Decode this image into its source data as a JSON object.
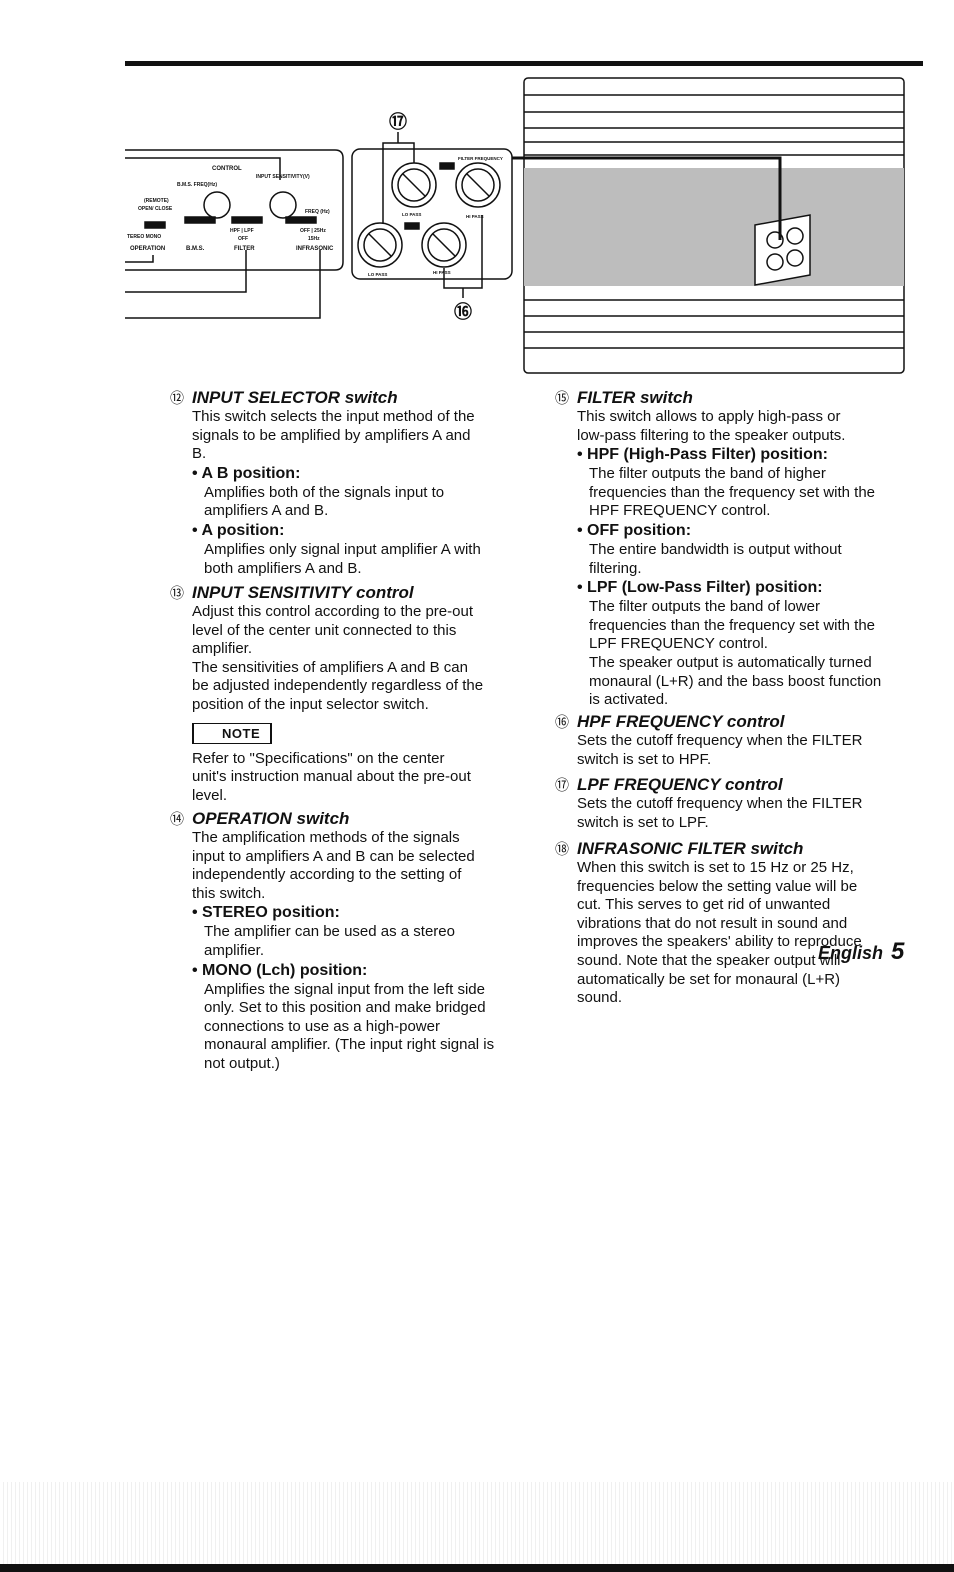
{
  "diagram": {
    "control": "CONTROL",
    "input_sensitivity": "INPUT SENSITIVITY(V)",
    "bms_freq": "B.M.S. FREQ(Hz)",
    "remote": "(REMOTE)",
    "open_close": "OPEN/ CLOSE",
    "stereo_mono": "TEREO  MONO",
    "hpf_lpf": "HPF | LPF",
    "off": "OFF",
    "freq_hz": "FREQ (Hz)",
    "off_25": "OFF | 25Hz",
    "hz15": "15Hz",
    "operation": "OPERATION",
    "bms": "B.M.S.",
    "filter": "FILTER",
    "infrasonic": "INFRASONIC",
    "filter_frequency": "FILTER FREQUENCY",
    "lo_pass": "LO PASS",
    "hi_pass": "HI PASS",
    "callout_17": "⑰",
    "callout_16": "⑯"
  },
  "left": {
    "s12": {
      "num": "⑫",
      "title": "INPUT SELECTOR switch",
      "body": "This switch selects the input method of the\nsignals to be amplified by amplifiers A and\nB.",
      "b1": "• A B position:",
      "b1_text": "Amplifies both of the signals input to\namplifiers A and B.",
      "b2": "• A position:",
      "b2_text": "Amplifies only signal input amplifier A with\nboth amplifiers A and B."
    },
    "s13": {
      "num": "⑬",
      "title": "INPUT SENSITIVITY control",
      "body": "Adjust this control according to the pre-out\nlevel of the center unit connected to this\namplifier.\nThe sensitivities of amplifiers A and B can\nbe adjusted independently regardless of the\nposition of the input selector switch.",
      "note_label": "NOTE",
      "note_text": "Refer to \"Specifications\" on the center\nunit's instruction manual about the pre-out\nlevel."
    },
    "s14": {
      "num": "⑭",
      "title": "OPERATION switch",
      "body": "The amplification methods of the signals\ninput to amplifiers A and B can be selected\nindependently according to the setting of\nthis switch.",
      "b1": "• STEREO position:",
      "b1_text": "The amplifier can be used as a stereo\namplifier.",
      "b2": "• MONO (Lch) position:",
      "b2_text": "Amplifies the signal input from the left side\nonly. Set to this position and make bridged\nconnections to use as a high-power\nmonaural amplifier. (The input right signal is\nnot output.)"
    }
  },
  "right": {
    "s15": {
      "num": "⑮",
      "title": "FILTER switch",
      "body": "This switch allows to apply high-pass or\nlow-pass filtering to the speaker outputs.",
      "b1": "• HPF (High-Pass Filter) position:",
      "b1_text": "The filter outputs the band of higher\nfrequencies than the frequency set with the\nHPF FREQUENCY control.",
      "b2": "• OFF position:",
      "b2_text": "The entire bandwidth is output without\nfiltering.",
      "b3": "• LPF (Low-Pass Filter) position:",
      "b3_text": "The filter outputs the band of lower\nfrequencies than the frequency set with the\nLPF FREQUENCY control.\nThe speaker output is automatically turned\nmonaural (L+R) and the bass boost function\nis activated."
    },
    "s16": {
      "num": "⑯",
      "title": "HPF FREQUENCY control",
      "body": "Sets the cutoff frequency when the FILTER\nswitch is set to HPF."
    },
    "s17": {
      "num": "⑰",
      "title": "LPF FREQUENCY control",
      "body": "Sets the cutoff frequency when the FILTER\nswitch is set to LPF."
    },
    "s18": {
      "num": "⑱",
      "title": "INFRASONIC FILTER switch",
      "body": "When this switch is set to 15 Hz or 25 Hz,\nfrequencies below the setting value will be\ncut. This serves to get rid of unwanted\nvibrations that do not result in sound and\nimproves the speakers' ability to reproduce\nsound. Note that the speaker output will\nautomatically be set for monaural (L+R)\nsound."
    }
  },
  "footer": {
    "language": "English",
    "page": "5"
  }
}
